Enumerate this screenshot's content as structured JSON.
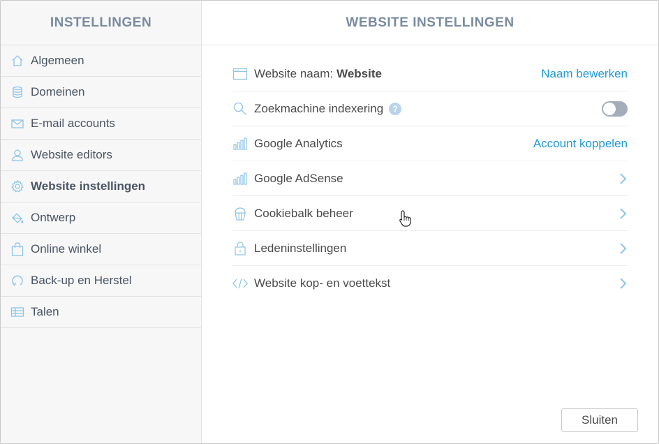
{
  "sidebar": {
    "title": "INSTELLINGEN",
    "items": [
      {
        "label": "Algemeen",
        "icon": "home-icon",
        "active": false
      },
      {
        "label": "Domeinen",
        "icon": "database-icon",
        "active": false
      },
      {
        "label": "E-mail accounts",
        "icon": "mail-icon",
        "active": false
      },
      {
        "label": "Website editors",
        "icon": "user-icon",
        "active": false
      },
      {
        "label": "Website instellingen",
        "icon": "gear-icon",
        "active": true
      },
      {
        "label": "Ontwerp",
        "icon": "paint-bucket-icon",
        "active": false
      },
      {
        "label": "Online winkel",
        "icon": "shopping-bag-icon",
        "active": false
      },
      {
        "label": "Back-up en Herstel",
        "icon": "restore-icon",
        "active": false
      },
      {
        "label": "Talen",
        "icon": "languages-icon",
        "active": false
      }
    ]
  },
  "main": {
    "title": "WEBSITE INSTELLINGEN",
    "rows": {
      "website_name": {
        "label": "Website naam:",
        "value": "Website",
        "action": "Naam bewerken",
        "icon": "browser-window-icon"
      },
      "indexing": {
        "label": "Zoekmachine indexering",
        "help": "?",
        "toggle_on": false,
        "icon": "search-icon"
      },
      "analytics": {
        "label": "Google Analytics",
        "action": "Account koppelen",
        "icon": "bar-chart-icon"
      },
      "adsense": {
        "label": "Google AdSense",
        "icon": "bar-chart-icon"
      },
      "cookiebar": {
        "label": "Cookiebalk beheer",
        "icon": "cupcake-icon"
      },
      "members": {
        "label": "Ledeninstellingen",
        "icon": "lock-icon"
      },
      "header_footer": {
        "label": "Website kop- en voettekst",
        "icon": "code-icon"
      }
    },
    "close_label": "Sluiten"
  },
  "colors": {
    "accent": "#1f9ad6",
    "icon": "#8ec5e6",
    "header_text": "#7a8ba0",
    "toggle_off": "#a4adb9"
  }
}
